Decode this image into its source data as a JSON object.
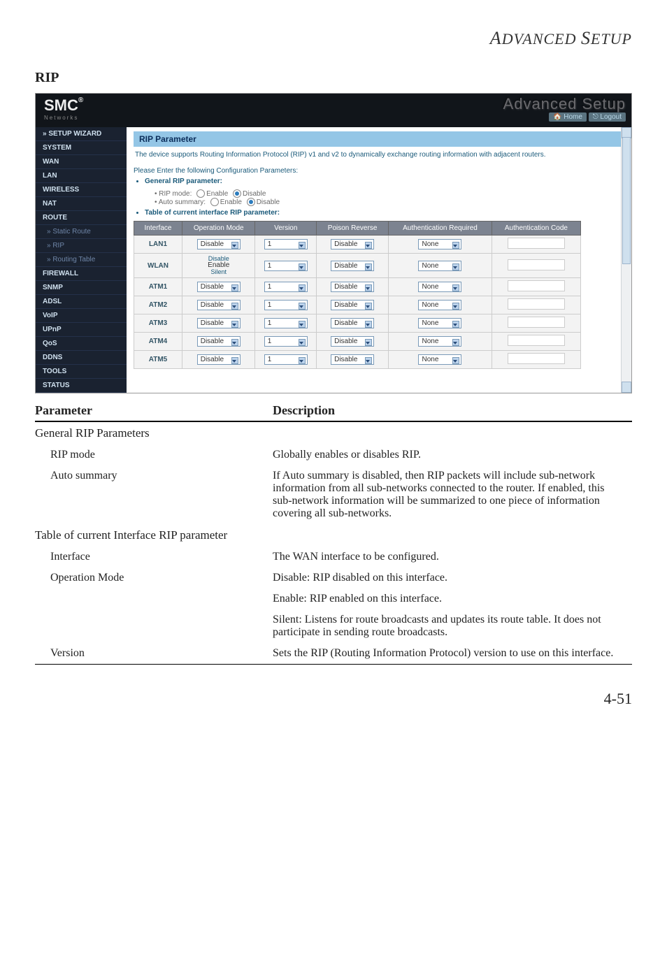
{
  "page": {
    "header": "ADVANCED SETUP",
    "section_title": "RIP",
    "page_number": "4-51"
  },
  "screenshot": {
    "logo": "SMC",
    "logo_sub": "Networks",
    "brand_right_big": "Advanced Setup",
    "home_label": "Home",
    "logout_label": "Logout",
    "sidebar": {
      "items": [
        "» SETUP WIZARD",
        "SYSTEM",
        "WAN",
        "LAN",
        "WIRELESS",
        "NAT",
        "ROUTE",
        "» Static Route",
        "» RIP",
        "» Routing Table",
        "FIREWALL",
        "SNMP",
        "ADSL",
        "VoIP",
        "UPnP",
        "QoS",
        "DDNS",
        "TOOLS",
        "STATUS"
      ]
    },
    "panel_heading": "RIP Parameter",
    "intro_text": "The device supports Routing Information Protocol (RIP) v1 and v2 to dynamically exchange routing information with adjacent routers.",
    "config_prompt": "Please Enter the following Configuration Parameters:",
    "general_bullet": "General RIP parameter:",
    "rip_mode_label": "RIP mode:",
    "auto_summary_label": "Auto summary:",
    "enable_label": "Enable",
    "disable_label": "Disable",
    "table_bullet": "Table of current interface RIP parameter:",
    "columns": {
      "interface": "Interface",
      "operation_mode": "Operation Mode",
      "version": "Version",
      "poison_reverse": "Poison Reverse",
      "auth_required": "Authentication Required",
      "auth_code": "Authentication Code"
    },
    "rows": [
      {
        "iface": "LAN1",
        "op": "Disable",
        "ver": "1",
        "pr": "Disable",
        "auth": "None"
      },
      {
        "iface": "WLAN",
        "op": "Enable",
        "op_extra": "Disable / Silent",
        "ver": "1",
        "pr": "Disable",
        "auth": "None"
      },
      {
        "iface": "ATM1",
        "op": "Disable",
        "ver": "1",
        "pr": "Disable",
        "auth": "None"
      },
      {
        "iface": "ATM2",
        "op": "Disable",
        "ver": "1",
        "pr": "Disable",
        "auth": "None"
      },
      {
        "iface": "ATM3",
        "op": "Disable",
        "ver": "1",
        "pr": "Disable",
        "auth": "None"
      },
      {
        "iface": "ATM4",
        "op": "Disable",
        "ver": "1",
        "pr": "Disable",
        "auth": "None"
      },
      {
        "iface": "ATM5",
        "op": "Disable",
        "ver": "1",
        "pr": "Disable",
        "auth": "None"
      }
    ]
  },
  "desc_table": {
    "header_param": "Parameter",
    "header_desc": "Description",
    "group1": "General RIP Parameters",
    "rows1": [
      {
        "p": "RIP mode",
        "d": "Globally enables or disables RIP."
      },
      {
        "p": "Auto summary",
        "d": "If Auto summary is disabled, then RIP packets will include sub-network information from all sub-networks connected to the router. If enabled, this sub-network information will be summarized to one piece of information covering all sub-networks."
      }
    ],
    "group2": "Table of current Interface RIP parameter",
    "rows2": [
      {
        "p": "Interface",
        "d": "The WAN interface to be configured."
      },
      {
        "p": "Operation Mode",
        "d": "Disable: RIP disabled on this interface."
      },
      {
        "p": "",
        "d": "Enable: RIP enabled on this interface."
      },
      {
        "p": "",
        "d": "Silent: Listens for route broadcasts and updates its route table. It does not participate in sending route broadcasts."
      },
      {
        "p": "Version",
        "d": "Sets the RIP (Routing Information Protocol) version to use on this interface."
      }
    ]
  }
}
